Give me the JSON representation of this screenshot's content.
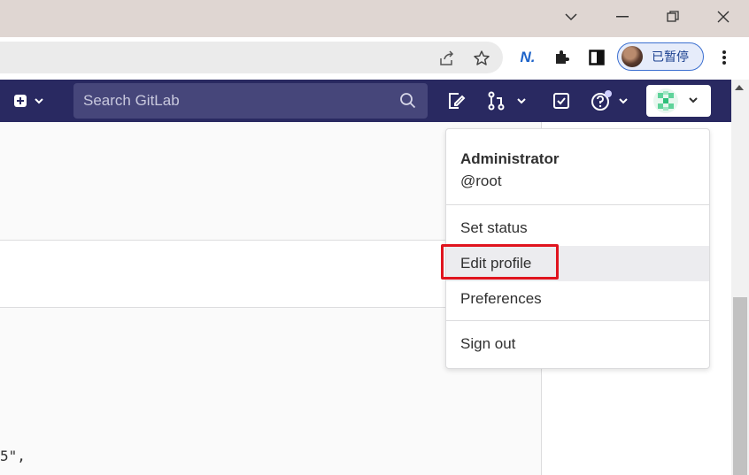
{
  "browser": {
    "profile_label": "已暂停",
    "ext_label": "N.",
    "window_controls": [
      "chevron-down-icon",
      "minimize-icon",
      "restore-icon",
      "close-icon"
    ]
  },
  "gitlab": {
    "search_placeholder": "Search GitLab",
    "brand_color": "#292961",
    "user_menu": {
      "name": "Administrator",
      "username": "@root",
      "items": [
        "Set status",
        "Edit profile",
        "Preferences",
        "Sign out"
      ],
      "highlighted": "Edit profile"
    }
  },
  "content": {
    "code_fragment": "5\","
  },
  "colors": {
    "accent": "#e0141e",
    "header": "#292961",
    "chrome_title": "#dfd6d2"
  }
}
